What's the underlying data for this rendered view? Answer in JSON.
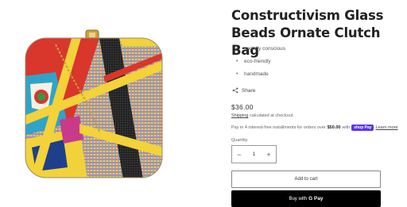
{
  "product": {
    "title": "Constructivism Glass Beads Ornate Clutch Bag",
    "features": [
      "socially conscious",
      "eco-friendly",
      "handmade"
    ],
    "share_label": "Share",
    "price": "$36.00",
    "shipping_link": "Shipping",
    "shipping_text": " calculated at checkout.",
    "installments_prefix": "Pay in 4 interest-free installments for orders over ",
    "installments_amount": "$50.00",
    "installments_with": " with ",
    "shop_pay_label": "shop Pay",
    "learn_more": "Learn more",
    "quantity_label": "Quantity",
    "quantity_value": "1",
    "decrement_symbol": "−",
    "increment_symbol": "+",
    "add_to_cart_label": "Add to cart",
    "buy_with_label": "Buy with",
    "gpay_label": "G Pay"
  },
  "icons": {
    "share": "share-icon",
    "product_image": "clutch-bag-image"
  }
}
